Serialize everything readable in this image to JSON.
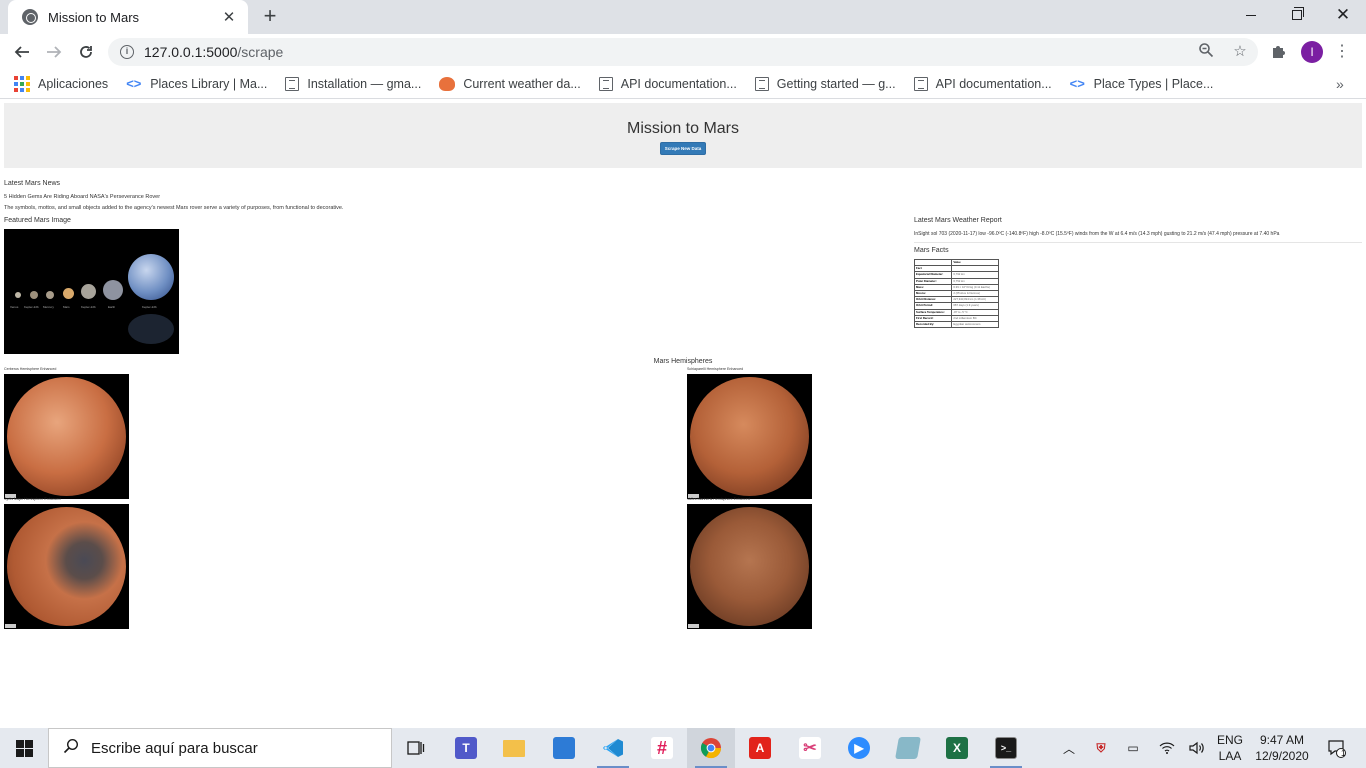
{
  "browser": {
    "tab_title": "Mission to Mars",
    "new_tab_symbol": "+",
    "url_host": "127.0.0.1:5000",
    "url_path": "/scrape",
    "profile_initial": "I",
    "bookmarks": [
      {
        "label": "Aplicaciones",
        "icon": "apps-grid-icon"
      },
      {
        "label": "Places Library  |  Ma...",
        "icon": "places-icon"
      },
      {
        "label": "Installation — gma...",
        "icon": "doc-icon"
      },
      {
        "label": "Current weather da...",
        "icon": "weather-icon"
      },
      {
        "label": "API documentation...",
        "icon": "doc-icon"
      },
      {
        "label": "Getting started — g...",
        "icon": "doc-icon"
      },
      {
        "label": "API documentation...",
        "icon": "doc-icon"
      },
      {
        "label": "Place Types  |  Place...",
        "icon": "places-icon"
      }
    ]
  },
  "page": {
    "title": "Mission to Mars",
    "scrape_button": "Scrape New Data",
    "news_heading": "Latest Mars News",
    "news_title": "5 Hidden Gems Are Riding Aboard NASA's Perseverance Rover",
    "news_paragraph": "The symbols, mottos, and small objects added to the agency's newest Mars rover serve a variety of purposes, from functional to decorative.",
    "featured_heading": "Featured Mars Image",
    "featured_labels": [
      "Venus",
      "Kepler-22b",
      "Mercury",
      "Mars",
      "Kepler-22b",
      "Earth",
      "Kepler-22b"
    ],
    "weather_heading": "Latest Mars Weather Report",
    "weather_text": "InSight sol 703 (2020-11-17) low -96.0ºC (-140.8ºF) high -8.0ºC (15.5ºF) winds from the W at 6.4 m/s (14.3 mph) gusting to 21.2 m/s (47.4 mph) pressure at 7.40 hPa",
    "facts_heading": "Mars Facts",
    "facts_header": [
      "",
      "Value"
    ],
    "facts_rows": [
      [
        "Fact",
        ""
      ],
      [
        "Equatorial Diameter:",
        "6,792 km"
      ],
      [
        "Polar Diameter:",
        "6,752 km"
      ],
      [
        "Mass:",
        "6.39 × 10^23 kg (0.11 Earths)"
      ],
      [
        "Moons:",
        "2 (Phobos & Deimos)"
      ],
      [
        "Orbit Distance:",
        "227,943,824 km (1.38 AU)"
      ],
      [
        "Orbit Period:",
        "687 days (1.9 years)"
      ],
      [
        "Surface Temperature:",
        "-87 to -5 °C"
      ],
      [
        "First Record:",
        "2nd millennium BC"
      ],
      [
        "Recorded By:",
        "Egyptian astronomers"
      ]
    ],
    "hemispheres_heading": "Mars Hemispheres",
    "hemispheres": [
      {
        "title": "Cerberus Hemisphere Enhanced"
      },
      {
        "title": "Schiaparelli Hemisphere Enhanced"
      },
      {
        "title": "Syrtis Major Hemisphere Enhanced"
      },
      {
        "title": "Valles Marineris Hemisphere Enhanced"
      }
    ]
  },
  "taskbar": {
    "search_placeholder": "Escribe aquí para buscar",
    "lang_top": "ENG",
    "lang_bottom": "LAA",
    "time": "9:47 AM",
    "date": "12/9/2020",
    "notification_count": "1"
  },
  "colors": {
    "scrape_button": "#337ab7",
    "jumbotron_bg": "#eeeeee",
    "profile": "#7b1fa2"
  }
}
